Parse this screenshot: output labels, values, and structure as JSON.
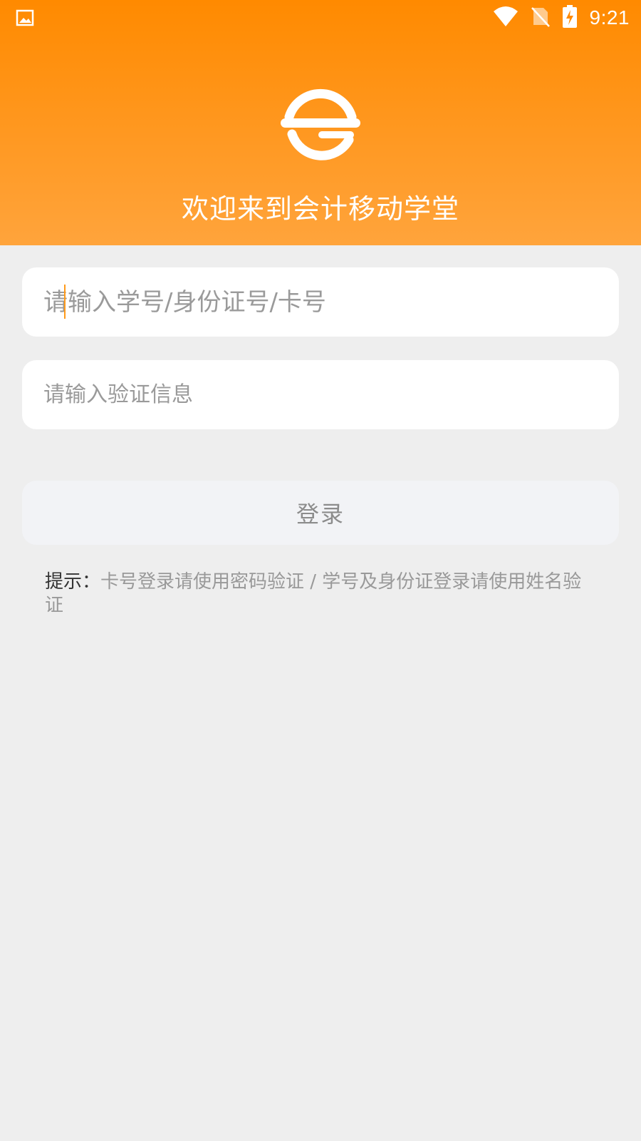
{
  "status_bar": {
    "time": "9:21",
    "icons": [
      "image-icon",
      "wifi-icon",
      "no-sim-icon",
      "battery-charging-icon"
    ]
  },
  "header": {
    "welcome_text": "欢迎来到会计移动学堂",
    "logo": "app-logo",
    "gradient": [
      "#ff8a00",
      "#ffa43c"
    ]
  },
  "form": {
    "account_placeholder": "请输入学号/身份证号/卡号",
    "account_value": "",
    "verify_placeholder": "请输入验证信息",
    "verify_value": "",
    "login_label": "登录"
  },
  "hint": {
    "label": "提示：",
    "text": "卡号登录请使用密码验证 / 学号及身份证登录请使用姓名验证"
  },
  "colors": {
    "accent": "#ff8a00",
    "background": "#eeeeee",
    "button_bg": "#f2f3f6"
  }
}
